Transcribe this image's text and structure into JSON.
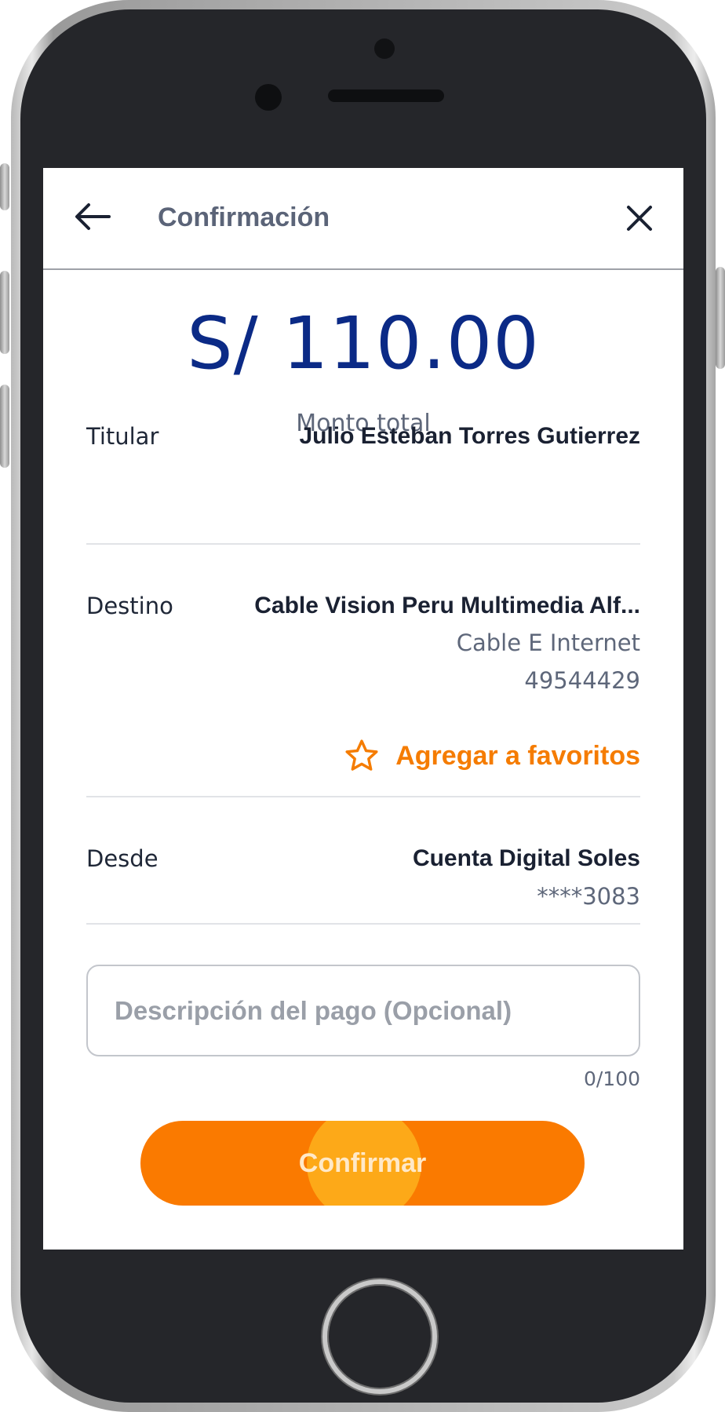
{
  "header": {
    "title": "Confirmación",
    "back_icon": "arrow-left-icon",
    "close_icon": "close-icon"
  },
  "summary": {
    "amount": "S/ 110.00",
    "amount_label": "Monto total"
  },
  "titular": {
    "label": "Titular",
    "value": "Julio Esteban Torres Gutierrez"
  },
  "destino": {
    "label": "Destino",
    "value": "Cable Vision Peru Multimedia Alf...",
    "service": "Cable E Internet",
    "code": "49544429"
  },
  "favorites": {
    "label": "Agregar a favoritos",
    "icon": "star-outline-icon"
  },
  "desde": {
    "label": "Desde",
    "value": "Cuenta Digital Soles",
    "account": "****3083"
  },
  "description": {
    "placeholder": "Descripción del pago (Opcional)",
    "value": "",
    "counter": "0/100"
  },
  "confirm": {
    "label": "Confirmar"
  },
  "colors": {
    "primary_blue": "#0b2a86",
    "accent_orange": "#fa7a00",
    "text_gray": "#5e677a"
  }
}
